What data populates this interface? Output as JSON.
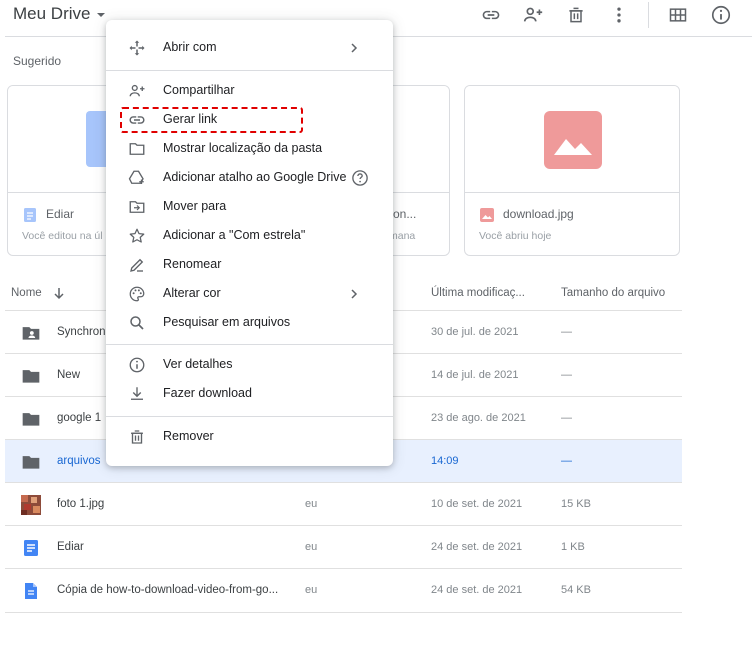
{
  "header": {
    "title": "Meu Drive",
    "icons": [
      "link-icon",
      "add-person-icon",
      "trash-icon",
      "more-vert-icon",
      "grid-view-icon",
      "info-icon"
    ]
  },
  "suggested": {
    "label": "Sugerido",
    "cards": [
      {
        "name": "Ediar",
        "sub": "Você editou na úl",
        "type": "doc"
      },
      {
        "name": "nts-on...",
        "sub": "mana",
        "type": "doc"
      },
      {
        "name": "download.jpg",
        "sub": "Você abriu hoje",
        "type": "image"
      }
    ]
  },
  "table": {
    "headers": {
      "name": "Nome",
      "modified": "Última modificaç...",
      "size": "Tamanho do arquivo"
    },
    "rows": [
      {
        "name": "Synchron",
        "owner": "",
        "modified": "30 de jul. de 2021",
        "size": "—",
        "type": "shared-folder"
      },
      {
        "name": "New",
        "owner": "",
        "modified": "14 de jul. de 2021",
        "size": "—",
        "type": "folder"
      },
      {
        "name": "google 1",
        "owner": "",
        "modified": "23 de ago. de 2021",
        "size": "—",
        "type": "folder"
      },
      {
        "name": "arquivos",
        "owner": "",
        "modified": "14:09",
        "size": "—",
        "type": "folder",
        "selected": true
      },
      {
        "name": "foto 1.jpg",
        "owner": "eu",
        "modified": "10 de set. de 2021",
        "size": "15 KB",
        "type": "photo"
      },
      {
        "name": "Ediar",
        "owner": "eu",
        "modified": "24 de set. de 2021",
        "size": "1 KB",
        "type": "doc"
      },
      {
        "name": "Cópia de how-to-download-video-from-go...",
        "owner": "eu",
        "modified": "24 de set. de 2021",
        "size": "54 KB",
        "type": "doc-file"
      }
    ]
  },
  "menu": {
    "items": [
      {
        "label": "Abrir com",
        "icon": "open-with-icon",
        "submenu": true
      },
      {
        "label": "Compartilhar",
        "icon": "share-person-icon"
      },
      {
        "label": "Gerar link",
        "icon": "link-icon",
        "highlighted": true
      },
      {
        "label": "Mostrar localização da pasta",
        "icon": "folder-outline-icon"
      },
      {
        "label": "Adicionar atalho ao Google Drive",
        "icon": "drive-shortcut-icon",
        "help": true
      },
      {
        "label": "Mover para",
        "icon": "move-to-icon"
      },
      {
        "label": "Adicionar a \"Com estrela\"",
        "icon": "star-outline-icon"
      },
      {
        "label": "Renomear",
        "icon": "pencil-icon"
      },
      {
        "label": "Alterar cor",
        "icon": "palette-icon",
        "submenu": true
      },
      {
        "label": "Pesquisar em arquivos",
        "icon": "search-icon"
      },
      {
        "label": "Ver detalhes",
        "icon": "info-icon"
      },
      {
        "label": "Fazer download",
        "icon": "download-icon"
      },
      {
        "label": "Remover",
        "icon": "trash-icon"
      }
    ]
  },
  "colors": {
    "accent": "#1967d2",
    "selected_row": "#e8f0fe",
    "doc_blue": "#4285f4",
    "image_red": "#ea4335",
    "highlight_red": "#e00000"
  }
}
